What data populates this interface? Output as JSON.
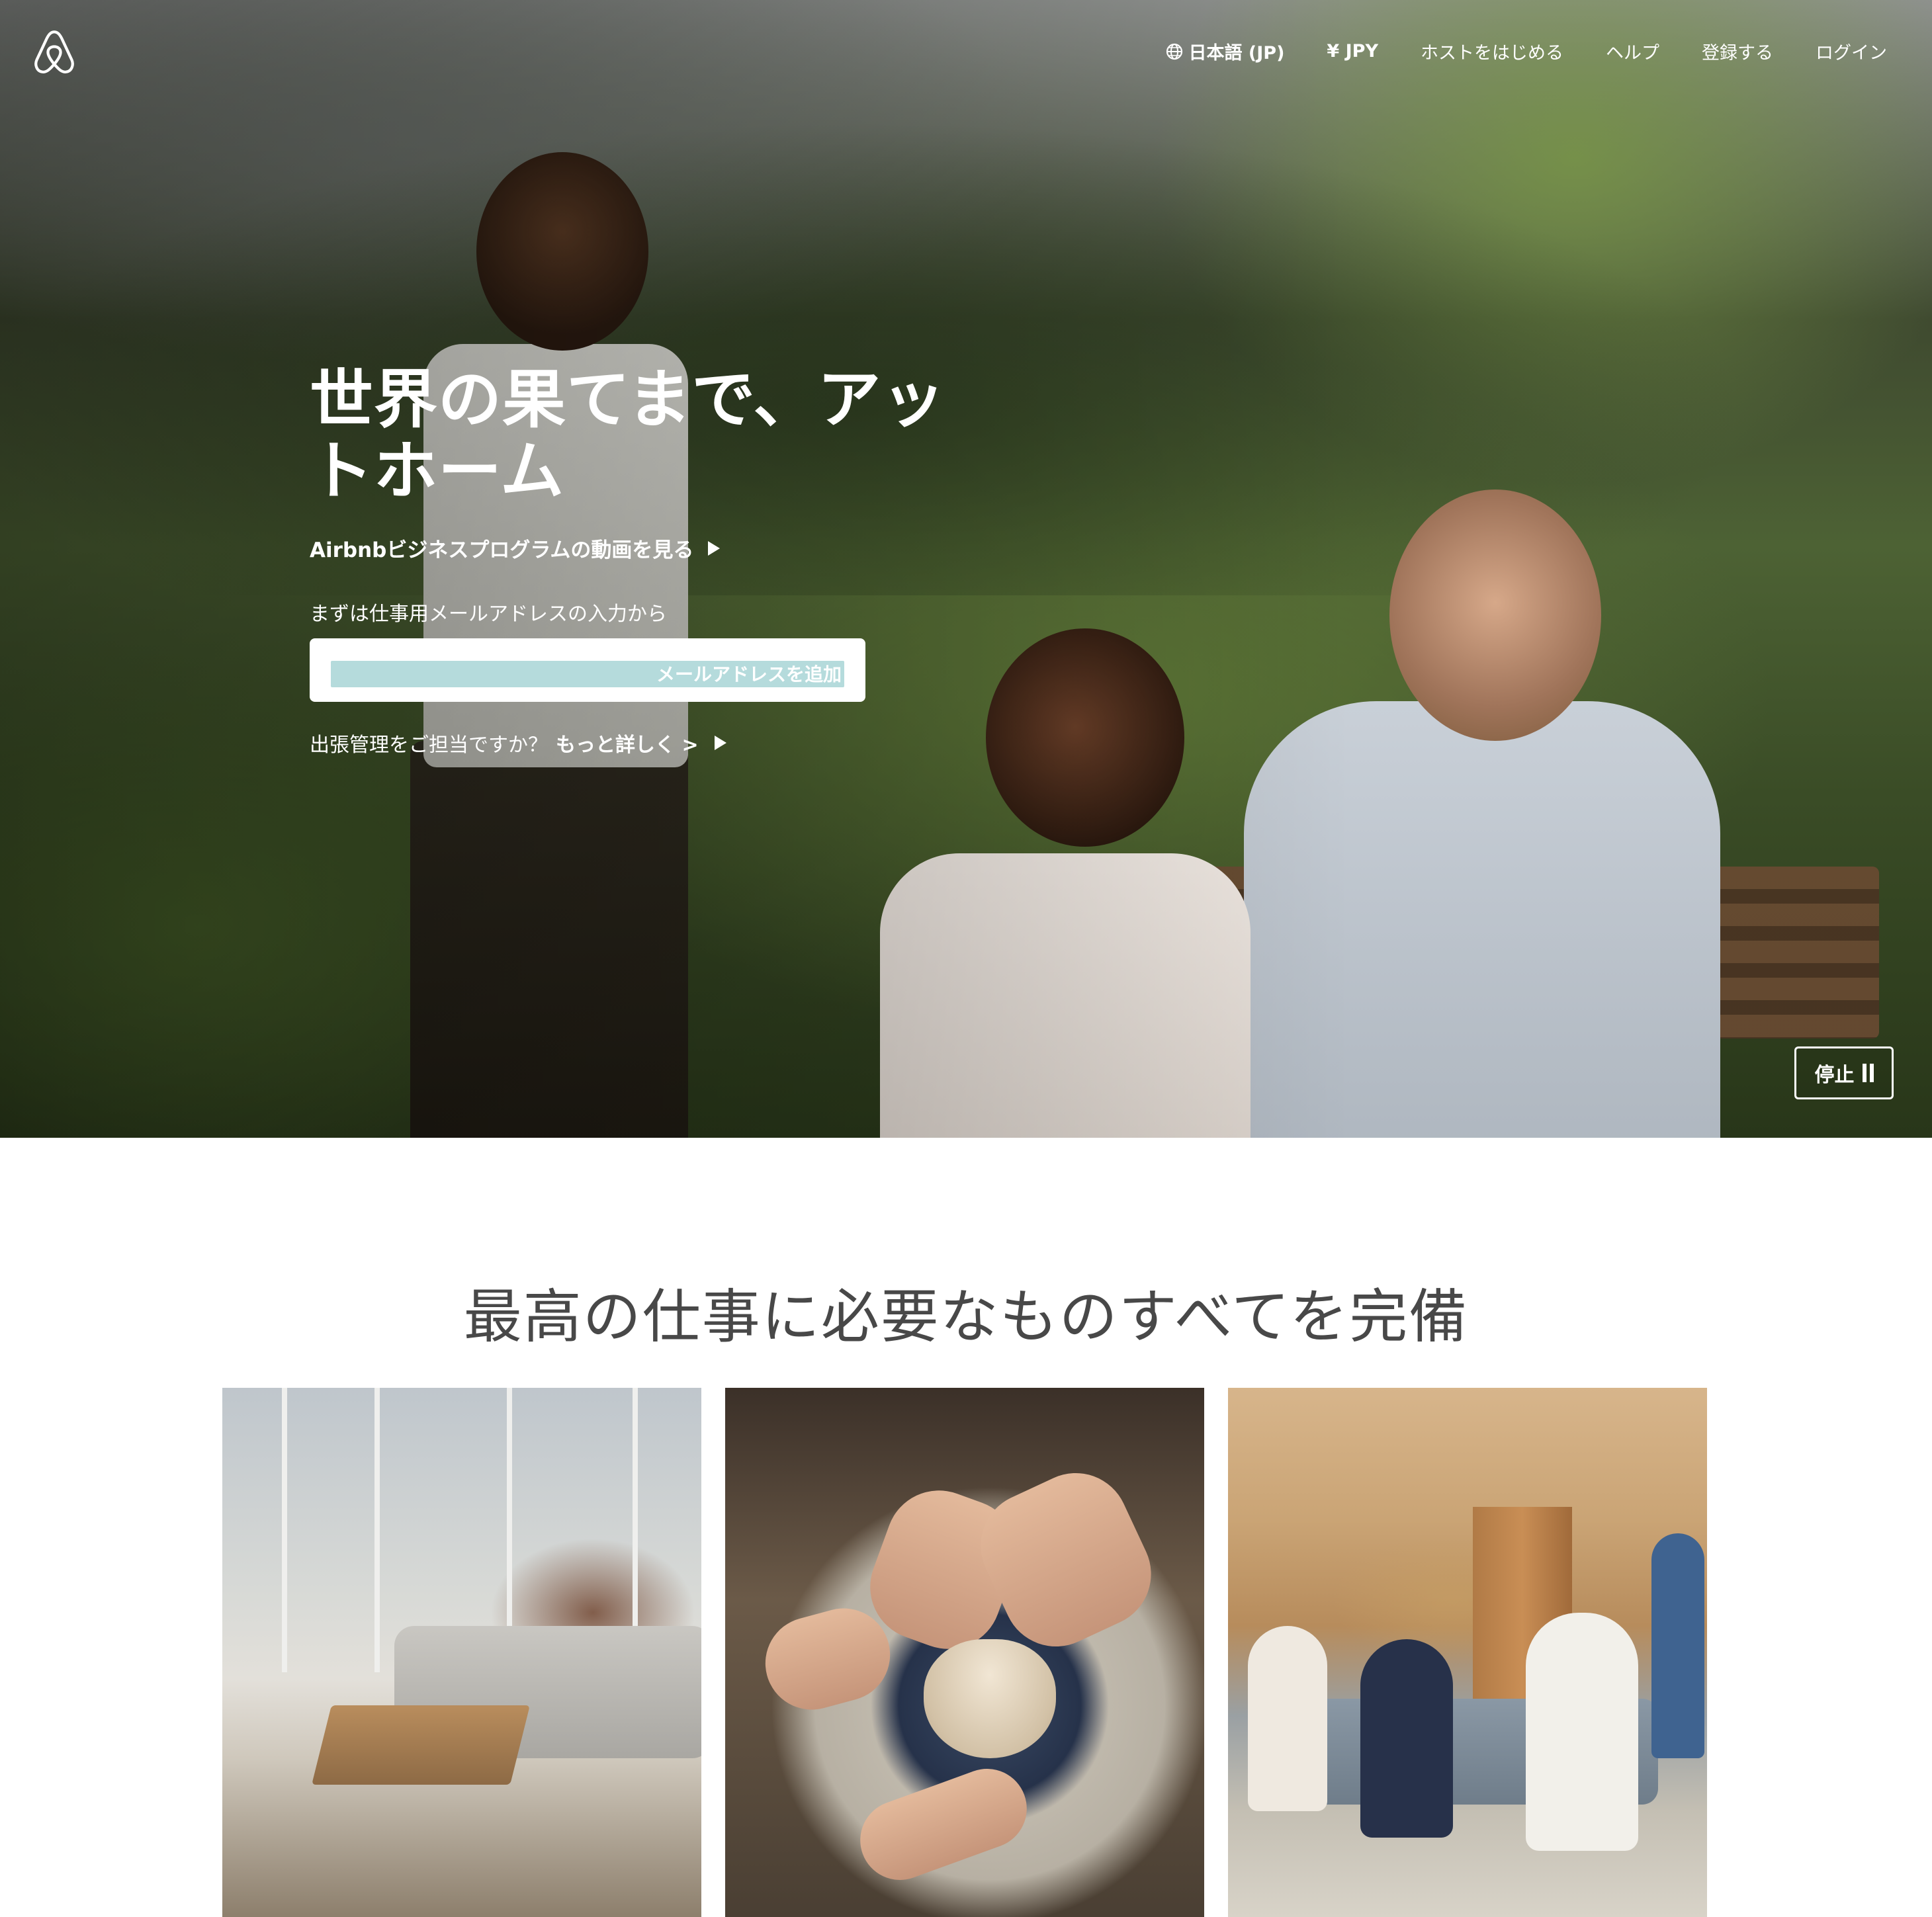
{
  "nav": {
    "language": "日本語 (JP)",
    "currency": "¥ JPY",
    "host": "ホストをはじめる",
    "help": "ヘルプ",
    "signup": "登録する",
    "login": "ログイン"
  },
  "hero": {
    "title": "世界の果てまで、アットホーム",
    "video_link": "Airbnbビジネスプログラムの動画を見る",
    "email_label": "まずは仕事用メールアドレスの入力から",
    "email_placeholder": "メールアドレスを追加",
    "manager_question": "出張管理をご担当ですか？",
    "manager_link": "もっと詳しく >",
    "pause_label": "停止"
  },
  "section": {
    "title": "最高の仕事に必要なものすべてを完備"
  },
  "icons": {
    "logo": "airbnb-logo",
    "language": "globe-icon",
    "video": "play-icon",
    "manager": "play-icon",
    "pause": "pause-icon"
  },
  "colors": {
    "input_fill": "#b5dbdc",
    "heading_text": "#484848",
    "hero_text": "#ffffff"
  }
}
